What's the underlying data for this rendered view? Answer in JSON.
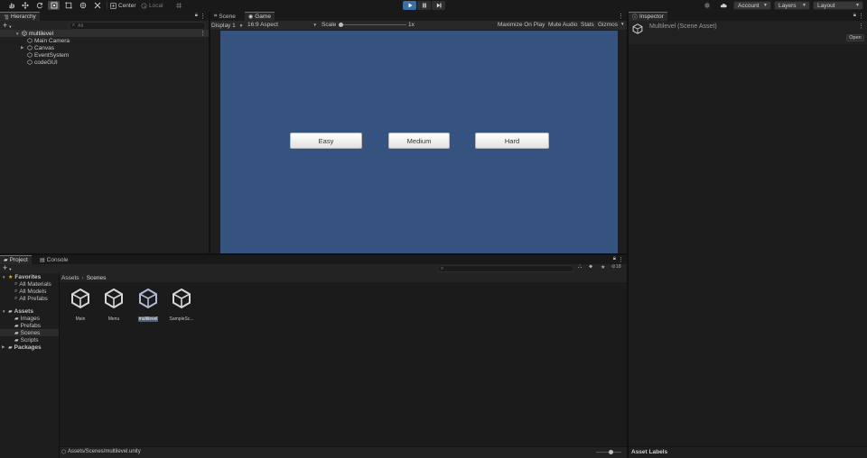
{
  "toolbar": {
    "pivot_label": "Center",
    "space_label": "Local",
    "account_label": "Account",
    "layers_label": "Layers",
    "layout_label": "Layout"
  },
  "hierarchy": {
    "tab_label": "Hierarchy",
    "search_placeholder": "All",
    "scene_name": "multilevel",
    "items": [
      {
        "label": "Main Camera"
      },
      {
        "label": "Canvas"
      },
      {
        "label": "EventSystem"
      },
      {
        "label": "codeGUI"
      }
    ]
  },
  "center": {
    "scene_tab": "Scene",
    "game_tab": "Game",
    "display": "Display 1",
    "aspect": "16:9 Aspect",
    "scale_label": "Scale",
    "scale_value": "1x",
    "maximize": "Maximize On Play",
    "mute": "Mute Audio",
    "stats": "Stats",
    "gizmos": "Gizmos",
    "game_bg": "#365380",
    "buttons": [
      {
        "label": "Easy"
      },
      {
        "label": "Medium"
      },
      {
        "label": "Hard"
      }
    ]
  },
  "inspector": {
    "tab_label": "Inspector",
    "title": "Multilevel (Scene Asset)",
    "open_label": "Open",
    "asset_labels": "Asset Labels"
  },
  "project": {
    "project_tab": "Project",
    "console_tab": "Console",
    "hidden_count": "18",
    "breadcrumb": [
      "Assets",
      "Scenes"
    ],
    "favorites_label": "Favorites",
    "favorites": [
      {
        "label": "All Materials"
      },
      {
        "label": "All Models"
      },
      {
        "label": "All Prefabs"
      }
    ],
    "assets_label": "Assets",
    "folders": [
      {
        "label": "Images"
      },
      {
        "label": "Prefabs"
      },
      {
        "label": "Scenes"
      },
      {
        "label": "Scripts"
      }
    ],
    "packages_label": "Packages",
    "files": [
      {
        "label": "Main"
      },
      {
        "label": "Menu"
      },
      {
        "label": "multilevel"
      },
      {
        "label": "SampleSc..."
      }
    ],
    "status_path": "Assets/Scenes/multilevel.unity"
  }
}
